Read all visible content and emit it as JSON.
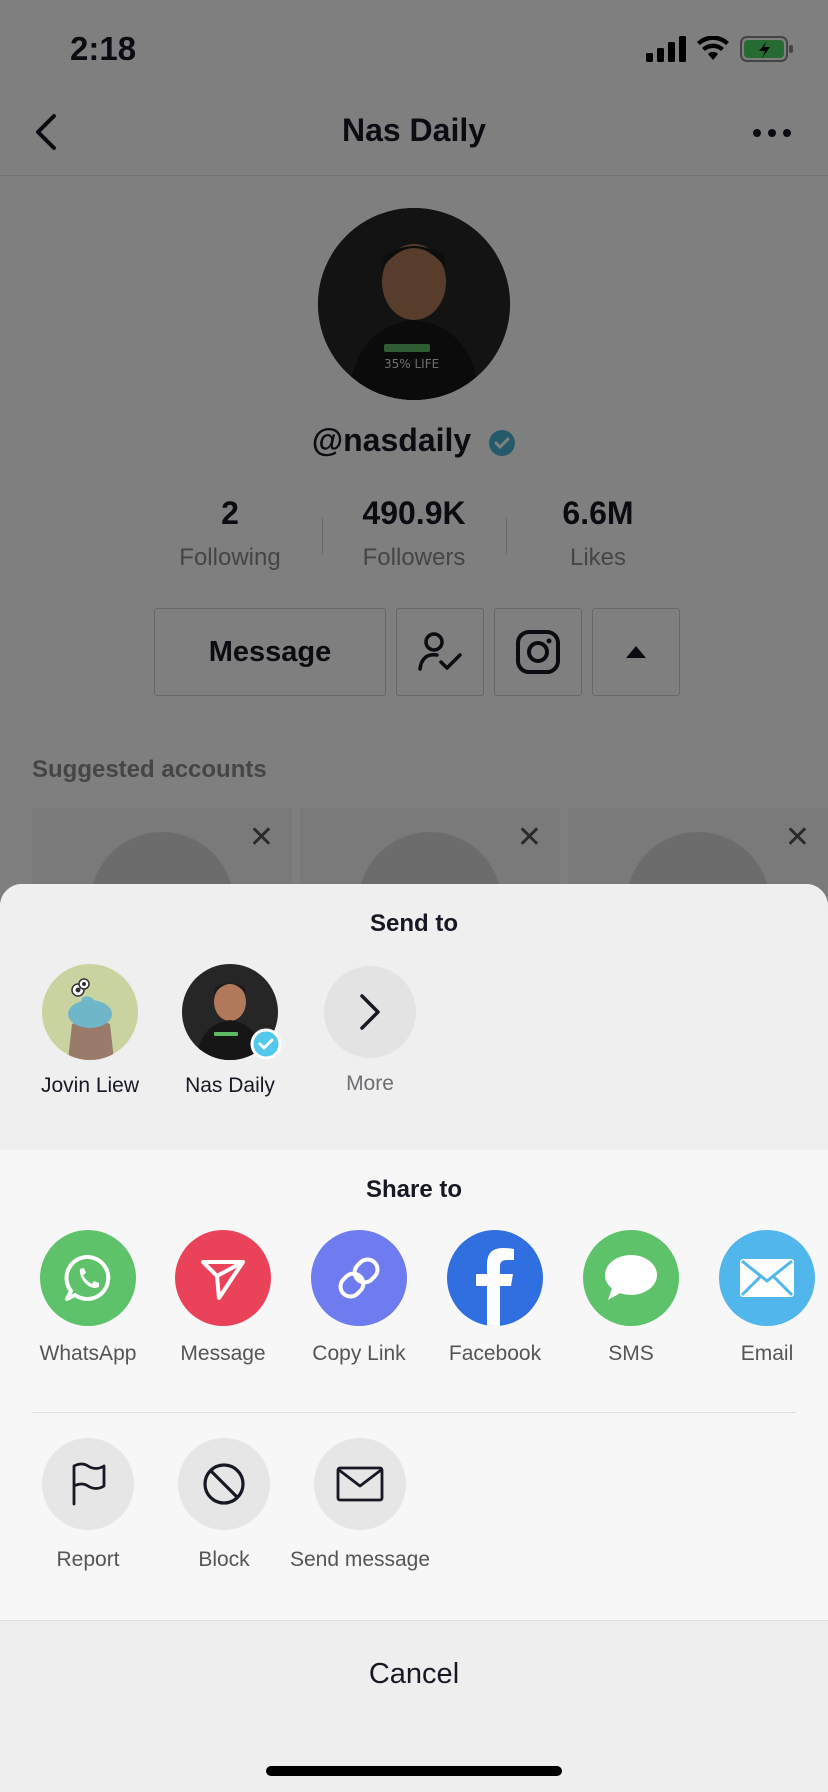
{
  "status": {
    "time": "2:18"
  },
  "nav": {
    "title": "Nas Daily"
  },
  "profile": {
    "handle": "@nasdaily",
    "shirt_text": "35% LIFE",
    "stats": [
      {
        "value": "2",
        "label": "Following"
      },
      {
        "value": "490.9K",
        "label": "Followers"
      },
      {
        "value": "6.6M",
        "label": "Likes"
      }
    ],
    "message_label": "Message",
    "suggested_title": "Suggested accounts"
  },
  "sheet": {
    "send_title": "Send to",
    "contacts": [
      {
        "name": "Jovin Liew"
      },
      {
        "name": "Nas Daily",
        "verified": true
      }
    ],
    "more_label": "More",
    "share_title": "Share to",
    "share_targets": [
      {
        "label": "WhatsApp",
        "color": "#5ec26a",
        "icon": "whatsapp-icon"
      },
      {
        "label": "Message",
        "color": "#ea4359",
        "icon": "send-icon"
      },
      {
        "label": "Copy Link",
        "color": "#6e7cf0",
        "icon": "link-icon"
      },
      {
        "label": "Facebook",
        "color": "#2f6fe0",
        "icon": "facebook-icon"
      },
      {
        "label": "SMS",
        "color": "#5ec26a",
        "icon": "sms-icon"
      },
      {
        "label": "Email",
        "color": "#50b6ec",
        "icon": "email-icon"
      }
    ],
    "options": [
      {
        "label": "Report",
        "icon": "flag-icon"
      },
      {
        "label": "Block",
        "icon": "block-icon"
      },
      {
        "label": "Send message",
        "icon": "envelope-icon"
      }
    ],
    "cancel_label": "Cancel"
  }
}
